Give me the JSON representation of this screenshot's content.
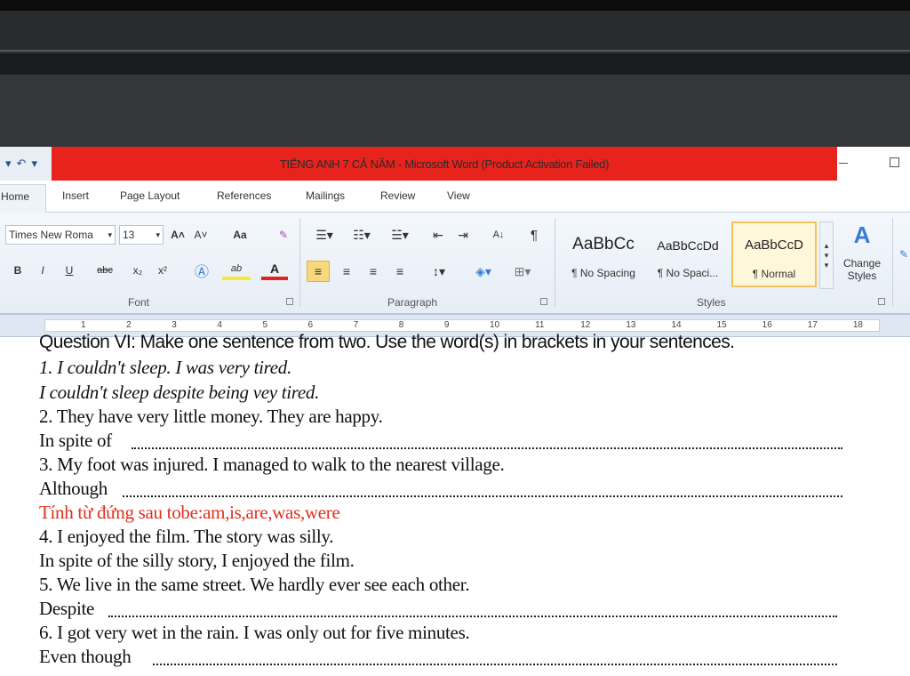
{
  "window": {
    "title": "TIẾNG ANH 7 CẢ NĂM - Microsoft Word (Product Activation Failed)"
  },
  "tabs": [
    "Home",
    "Insert",
    "Page Layout",
    "References",
    "Mailings",
    "Review",
    "View"
  ],
  "font_group": {
    "font_name": "Times New Roma",
    "font_size": "13",
    "label": "Font",
    "bold": "B",
    "italic": "I",
    "underline": "U",
    "strike": "abc",
    "subscript": "x₂",
    "superscript": "x²",
    "grow": "A˄",
    "shrink": "A˅",
    "case": "Aa",
    "highlight": "ab",
    "font_color": "A"
  },
  "paragraph_group": {
    "label": "Paragraph",
    "pilcrow": "¶",
    "sort": "A↓"
  },
  "styles_group": {
    "label": "Styles",
    "tiles": [
      {
        "sample": "AaBbCc",
        "name": "¶ No Spacing"
      },
      {
        "sample": "AaBbCcDd",
        "name": "¶ No Spaci..."
      },
      {
        "sample": "AaBbCcD",
        "name": "¶ Normal"
      }
    ],
    "change_styles": "Change Styles"
  },
  "ruler": {
    "numbers": [
      "1",
      "2",
      "3",
      "4",
      "5",
      "6",
      "7",
      "8",
      "9",
      "10",
      "11",
      "12",
      "13",
      "14",
      "15",
      "16",
      "17",
      "18"
    ]
  },
  "document": {
    "heading": "Question VI: Make one sentence from two. Use the word(s) in brackets in your sentences.",
    "lines": [
      "1. I couldn't sleep.     I was very tired.",
      "I couldn't sleep despite being vey tired.",
      "2. They have very little money. They are happy.",
      "In spite of",
      "3. My foot was injured. I managed to walk to the nearest village.",
      "Although",
      "Tính từ đứng sau tobe:am,is,are,was,were",
      "4. I enjoyed the film. The story was silly.",
      "In spite of the silly story, I enjoyed the film.",
      "5. We live in the same street. We hardly ever see each other.",
      "Despite",
      "6. I got very wet in the rain. I was only out for five minutes.",
      "Even though"
    ]
  },
  "colors": {
    "title_bar": "#e8231c",
    "note_red": "#e0301e",
    "style_selected": "#f2c35b"
  }
}
